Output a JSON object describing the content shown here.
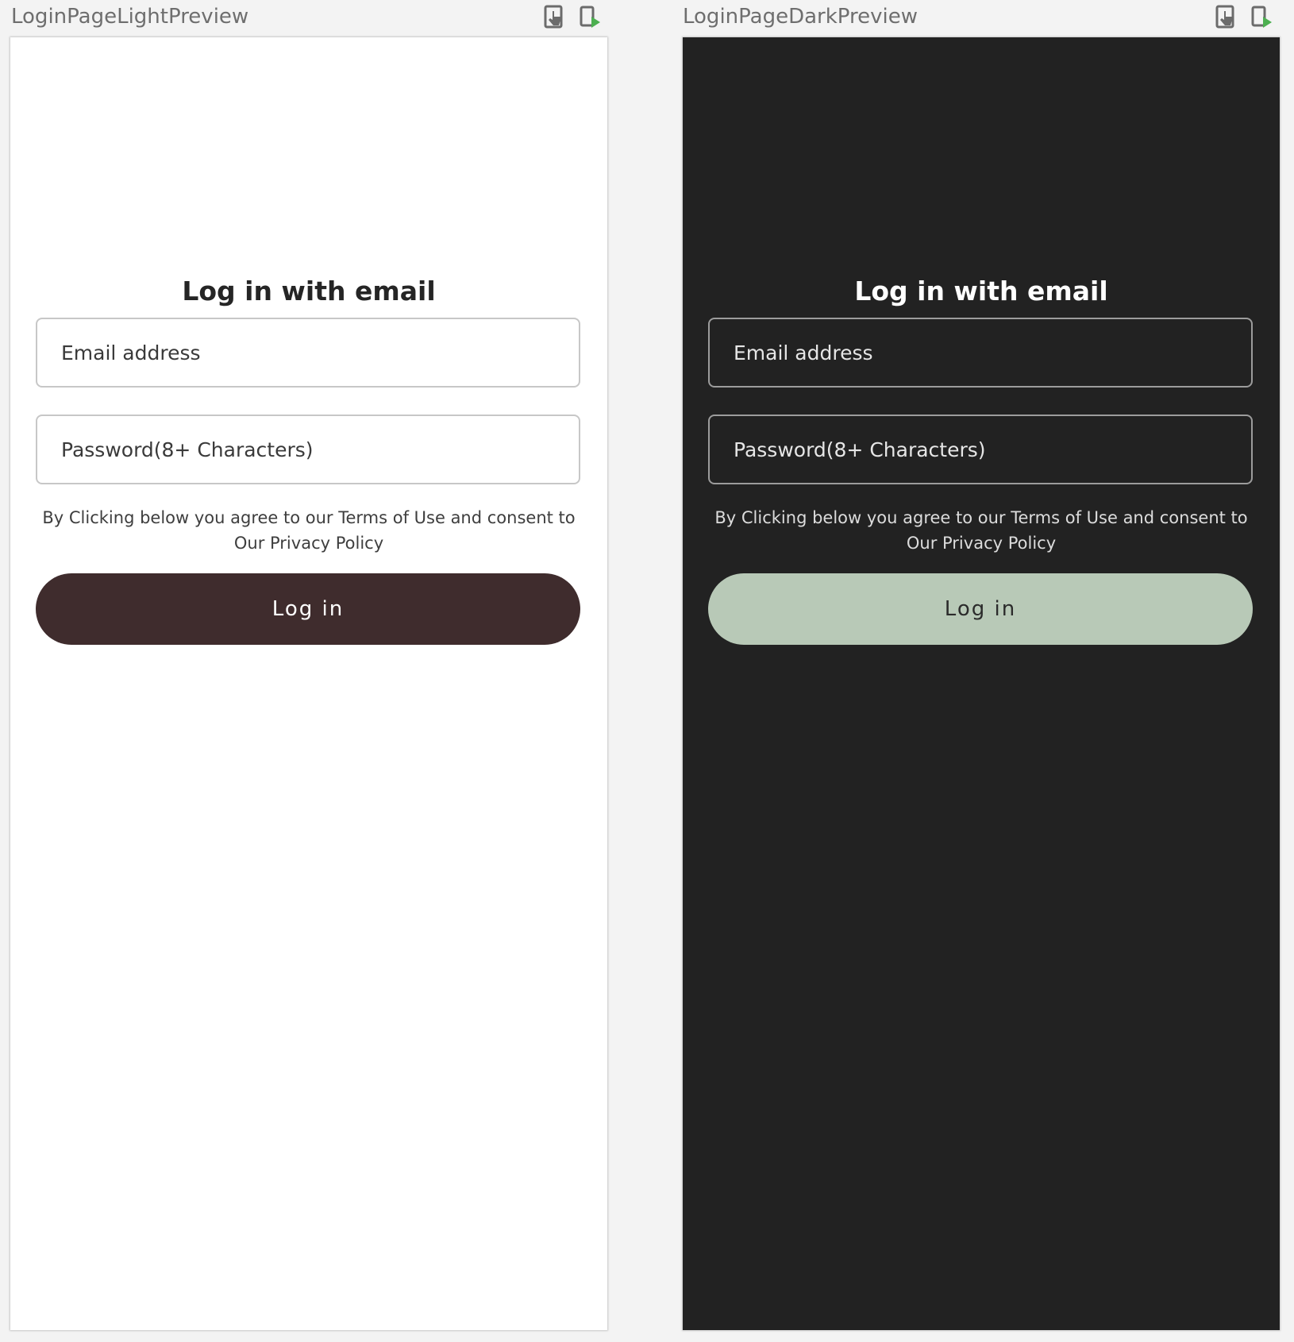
{
  "previews": {
    "light": {
      "title": "LoginPageLightPreview",
      "heading": "Log in with email",
      "email_placeholder": "Email address",
      "password_placeholder": "Password(8+ Characters)",
      "legal_text": "By Clicking below you agree to our Terms of Use and consent to Our Privacy Policy",
      "login_label": "Log in"
    },
    "dark": {
      "title": "LoginPageDarkPreview",
      "heading": "Log in with email",
      "email_placeholder": "Email address",
      "password_placeholder": "Password(8+ Characters)",
      "legal_text": "By Clicking below you agree to our Terms of Use and consent to Our Privacy Policy",
      "login_label": "Log in"
    }
  },
  "toolbar_icons": [
    "interactive-mode-icon",
    "deploy-to-device-icon"
  ],
  "colors": {
    "light_surface": "#ffffff",
    "light_button": "#3f2c2d",
    "dark_surface": "#222222",
    "dark_button": "#b8c9b7",
    "canvas_background": "#f3f3f3",
    "run_accent": "#4caf50"
  }
}
